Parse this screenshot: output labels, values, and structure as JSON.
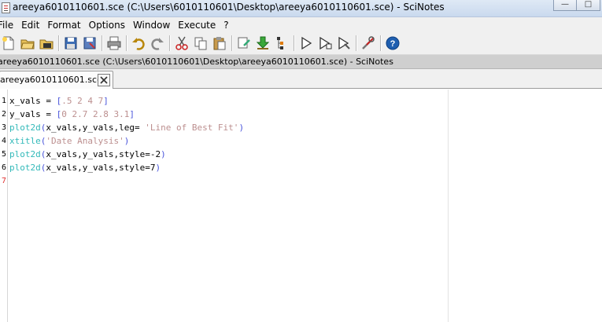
{
  "window": {
    "title": "areeya6010110601.sce (C:\\Users\\6010110601\\Desktop\\areeya6010110601.sce) - SciNotes",
    "controls": [
      "minimize",
      "maximize"
    ]
  },
  "menu": [
    "File",
    "Edit",
    "Format",
    "Options",
    "Window",
    "Execute",
    "?"
  ],
  "toolbar": {
    "buttons": [
      {
        "icon": "new-file-icon"
      },
      {
        "icon": "open-folder-icon"
      },
      {
        "icon": "open-recent-icon"
      },
      {
        "icon": "save-icon"
      },
      {
        "icon": "save-as-icon"
      },
      {
        "icon": "print-icon"
      },
      {
        "icon": "undo-icon"
      },
      {
        "icon": "redo-icon"
      },
      {
        "icon": "cut-icon"
      },
      {
        "icon": "copy-icon"
      },
      {
        "icon": "paste-icon"
      },
      {
        "icon": "find-replace-icon"
      },
      {
        "icon": "load-into-scilab-icon"
      },
      {
        "icon": "variable-browser-icon"
      },
      {
        "icon": "execute-icon"
      },
      {
        "icon": "execute-until-icon"
      },
      {
        "icon": "execute-file-icon"
      },
      {
        "icon": "preferences-icon"
      },
      {
        "icon": "help-icon"
      }
    ]
  },
  "path_bar": "areeya6010110601.sce (C:\\Users\\6010110601\\Desktop\\areeya6010110601.sce) - SciNotes",
  "tabs": [
    {
      "label": "areeya6010110601.sce",
      "active": true
    }
  ],
  "editor": {
    "line_numbers": [
      "1",
      "2",
      "3",
      "4",
      "5",
      "6",
      "7"
    ],
    "current_line": "7",
    "lines": [
      [
        {
          "t": "ident",
          "v": "x_vals"
        },
        {
          "t": "eq",
          "v": " = "
        },
        {
          "t": "br",
          "v": "["
        },
        {
          "t": "num",
          "v": ".5 2 4 7"
        },
        {
          "t": "br",
          "v": "]"
        }
      ],
      [
        {
          "t": "ident",
          "v": "y_vals"
        },
        {
          "t": "eq",
          "v": " = "
        },
        {
          "t": "br",
          "v": "["
        },
        {
          "t": "num",
          "v": "0 2.7 2.8 3.1"
        },
        {
          "t": "br",
          "v": "]"
        }
      ],
      [
        {
          "t": "func",
          "v": "plot2d"
        },
        {
          "t": "br",
          "v": "("
        },
        {
          "t": "ident",
          "v": "x_vals,y_vals,leg= "
        },
        {
          "t": "str",
          "v": "'Line of Best Fit'"
        },
        {
          "t": "br",
          "v": ")"
        }
      ],
      [
        {
          "t": "func",
          "v": "xtitle"
        },
        {
          "t": "br",
          "v": "("
        },
        {
          "t": "str",
          "v": "'Date Analysis'"
        },
        {
          "t": "br",
          "v": ")"
        }
      ],
      [
        {
          "t": "func",
          "v": "plot2d"
        },
        {
          "t": "br",
          "v": "("
        },
        {
          "t": "ident",
          "v": "x_vals,y_vals,style=-2"
        },
        {
          "t": "br",
          "v": ")"
        }
      ],
      [
        {
          "t": "func",
          "v": "plot2d"
        },
        {
          "t": "br",
          "v": "("
        },
        {
          "t": "ident",
          "v": "x_vals,y_vals,style=7"
        },
        {
          "t": "br",
          "v": ")"
        }
      ],
      []
    ]
  },
  "colors": {
    "keyword_function": "#32b9b9",
    "string": "#bc8f8f",
    "bracket": "#4a55db",
    "current_line_number": "#e03030"
  }
}
